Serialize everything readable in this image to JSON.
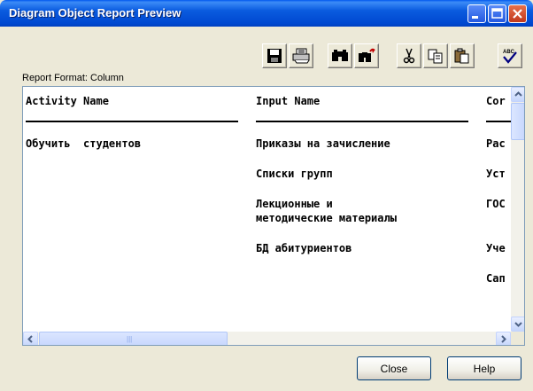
{
  "window": {
    "title": "Diagram Object Report Preview"
  },
  "toolbar": {
    "buttons": [
      {
        "name": "save-icon"
      },
      {
        "name": "print-icon"
      },
      {
        "name": "find-icon"
      },
      {
        "name": "find-next-icon"
      },
      {
        "name": "cut-icon"
      },
      {
        "name": "copy-icon"
      },
      {
        "name": "paste-icon"
      },
      {
        "name": "spellcheck-icon"
      }
    ],
    "spell_label": "ABC"
  },
  "report": {
    "format_label": "Report Format: Column",
    "columns": [
      "Activity Name",
      "Input Name",
      "Cor"
    ],
    "activity": "Обучить  студентов",
    "inputs": [
      "Приказы на зачисление",
      "Списки групп",
      "Лекционные и\nметодические материалы",
      "БД абитуриентов"
    ],
    "third_column": [
      "Рас",
      "Уст",
      "ГОС",
      "Уче",
      "Сап"
    ]
  },
  "scroll": {
    "h_thumb_grip": "|||"
  },
  "buttons": {
    "close": "Close",
    "help": "Help"
  },
  "colors": {
    "titlebar": "#0A5BDF",
    "face": "#ECE9D8",
    "close_button": "#C0381C"
  }
}
